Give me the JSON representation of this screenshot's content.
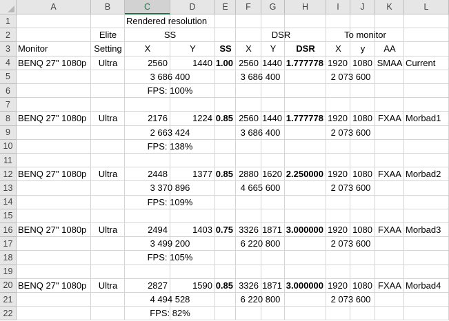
{
  "spreadsheet": {
    "columns": [
      "A",
      "B",
      "C",
      "D",
      "E",
      "F",
      "G",
      "H",
      "I",
      "J",
      "K",
      "L"
    ],
    "rows": [
      "1",
      "2",
      "3",
      "4",
      "5",
      "6",
      "7",
      "8",
      "9",
      "10",
      "11",
      "12",
      "13",
      "14",
      "15",
      "16",
      "17",
      "18",
      "19",
      "20",
      "21",
      "22"
    ],
    "cells": [
      {
        "r": 1,
        "c": "C",
        "text": "Rendered resolution",
        "align": "left"
      },
      {
        "r": 2,
        "c": "B",
        "text": "Elite",
        "align": "center"
      },
      {
        "r": 2,
        "c": "C",
        "text": "SS",
        "align": "center",
        "span": "CD"
      },
      {
        "r": 2,
        "c": "F",
        "text": "DSR",
        "align": "center",
        "span": "FH"
      },
      {
        "r": 2,
        "c": "I",
        "text": "To monitor",
        "align": "center",
        "span": "IK"
      },
      {
        "r": 3,
        "c": "A",
        "text": "Monitor",
        "align": "left"
      },
      {
        "r": 3,
        "c": "B",
        "text": "Setting",
        "align": "center"
      },
      {
        "r": 3,
        "c": "C",
        "text": "X",
        "align": "center",
        "span": "C"
      },
      {
        "r": 3,
        "c": "D",
        "text": "Y",
        "align": "center"
      },
      {
        "r": 3,
        "c": "E",
        "text": "SS",
        "align": "center",
        "bold": true
      },
      {
        "r": 3,
        "c": "F",
        "text": "X",
        "align": "center"
      },
      {
        "r": 3,
        "c": "G",
        "text": "Y",
        "align": "center"
      },
      {
        "r": 3,
        "c": "H",
        "text": "DSR",
        "align": "center",
        "bold": true
      },
      {
        "r": 3,
        "c": "I",
        "text": "X",
        "align": "center"
      },
      {
        "r": 3,
        "c": "J",
        "text": "y",
        "align": "center"
      },
      {
        "r": 3,
        "c": "K",
        "text": "AA",
        "align": "center"
      },
      {
        "r": 4,
        "c": "A",
        "text": "BENQ  27\" 1080p",
        "align": "left"
      },
      {
        "r": 4,
        "c": "B",
        "text": "Ultra",
        "align": "center"
      },
      {
        "r": 4,
        "c": "C",
        "text": "2560",
        "align": "right"
      },
      {
        "r": 4,
        "c": "D",
        "text": "1440",
        "align": "right"
      },
      {
        "r": 4,
        "c": "E",
        "text": "1.00",
        "align": "right",
        "bold": true
      },
      {
        "r": 4,
        "c": "F",
        "text": "2560",
        "align": "right"
      },
      {
        "r": 4,
        "c": "G",
        "text": "1440",
        "align": "right"
      },
      {
        "r": 4,
        "c": "H",
        "text": "1.777778",
        "align": "right",
        "bold": true
      },
      {
        "r": 4,
        "c": "I",
        "text": "1920",
        "align": "right"
      },
      {
        "r": 4,
        "c": "J",
        "text": "1080",
        "align": "right"
      },
      {
        "r": 4,
        "c": "K",
        "text": "SMAA",
        "align": "center"
      },
      {
        "r": 4,
        "c": "L",
        "text": "Current",
        "align": "left"
      },
      {
        "r": 5,
        "c": "C",
        "text": "3 686 400",
        "align": "center",
        "span": "CD"
      },
      {
        "r": 5,
        "c": "F",
        "text": "3 686 400",
        "align": "center",
        "span": "FG"
      },
      {
        "r": 5,
        "c": "I",
        "text": "2 073 600",
        "align": "center",
        "span": "IJ"
      },
      {
        "r": 6,
        "c": "C",
        "text": "FPS: 100%",
        "align": "center",
        "span": "CD"
      },
      {
        "r": 8,
        "c": "A",
        "text": "BENQ  27\" 1080p",
        "align": "left"
      },
      {
        "r": 8,
        "c": "B",
        "text": "Ultra",
        "align": "center"
      },
      {
        "r": 8,
        "c": "C",
        "text": "2176",
        "align": "right"
      },
      {
        "r": 8,
        "c": "D",
        "text": "1224",
        "align": "right"
      },
      {
        "r": 8,
        "c": "E",
        "text": "0.85",
        "align": "right",
        "bold": true
      },
      {
        "r": 8,
        "c": "F",
        "text": "2560",
        "align": "right"
      },
      {
        "r": 8,
        "c": "G",
        "text": "1440",
        "align": "right"
      },
      {
        "r": 8,
        "c": "H",
        "text": "1.777778",
        "align": "right",
        "bold": true
      },
      {
        "r": 8,
        "c": "I",
        "text": "1920",
        "align": "right"
      },
      {
        "r": 8,
        "c": "J",
        "text": "1080",
        "align": "right"
      },
      {
        "r": 8,
        "c": "K",
        "text": "FXAA",
        "align": "center"
      },
      {
        "r": 8,
        "c": "L",
        "text": "Morbad1",
        "align": "left"
      },
      {
        "r": 9,
        "c": "C",
        "text": "2 663 424",
        "align": "center",
        "span": "CD"
      },
      {
        "r": 9,
        "c": "F",
        "text": "3 686 400",
        "align": "center",
        "span": "FG"
      },
      {
        "r": 9,
        "c": "I",
        "text": "2 073 600",
        "align": "center",
        "span": "IJ"
      },
      {
        "r": 10,
        "c": "C",
        "text": "FPS: 138%",
        "align": "center",
        "span": "CD"
      },
      {
        "r": 12,
        "c": "A",
        "text": "BENQ  27\" 1080p",
        "align": "left"
      },
      {
        "r": 12,
        "c": "B",
        "text": "Ultra",
        "align": "center"
      },
      {
        "r": 12,
        "c": "C",
        "text": "2448",
        "align": "right"
      },
      {
        "r": 12,
        "c": "D",
        "text": "1377",
        "align": "right"
      },
      {
        "r": 12,
        "c": "E",
        "text": "0.85",
        "align": "right",
        "bold": true
      },
      {
        "r": 12,
        "c": "F",
        "text": "2880",
        "align": "right"
      },
      {
        "r": 12,
        "c": "G",
        "text": "1620",
        "align": "right"
      },
      {
        "r": 12,
        "c": "H",
        "text": "2.250000",
        "align": "right",
        "bold": true
      },
      {
        "r": 12,
        "c": "I",
        "text": "1920",
        "align": "right"
      },
      {
        "r": 12,
        "c": "J",
        "text": "1080",
        "align": "right"
      },
      {
        "r": 12,
        "c": "K",
        "text": "FXAA",
        "align": "center"
      },
      {
        "r": 12,
        "c": "L",
        "text": "Morbad2",
        "align": "left"
      },
      {
        "r": 13,
        "c": "C",
        "text": "3 370 896",
        "align": "center",
        "span": "CD"
      },
      {
        "r": 13,
        "c": "F",
        "text": "4 665 600",
        "align": "center",
        "span": "FG"
      },
      {
        "r": 13,
        "c": "I",
        "text": "2 073 600",
        "align": "center",
        "span": "IJ"
      },
      {
        "r": 14,
        "c": "C",
        "text": "FPS: 109%",
        "align": "center",
        "span": "CD"
      },
      {
        "r": 16,
        "c": "A",
        "text": "BENQ  27\" 1080p",
        "align": "left"
      },
      {
        "r": 16,
        "c": "B",
        "text": "Ultra",
        "align": "center"
      },
      {
        "r": 16,
        "c": "C",
        "text": "2494",
        "align": "right"
      },
      {
        "r": 16,
        "c": "D",
        "text": "1403",
        "align": "right"
      },
      {
        "r": 16,
        "c": "E",
        "text": "0.75",
        "align": "right",
        "bold": true
      },
      {
        "r": 16,
        "c": "F",
        "text": "3326",
        "align": "right"
      },
      {
        "r": 16,
        "c": "G",
        "text": "1871",
        "align": "right"
      },
      {
        "r": 16,
        "c": "H",
        "text": "3.000000",
        "align": "right",
        "bold": true
      },
      {
        "r": 16,
        "c": "I",
        "text": "1920",
        "align": "right"
      },
      {
        "r": 16,
        "c": "J",
        "text": "1080",
        "align": "right"
      },
      {
        "r": 16,
        "c": "K",
        "text": "FXAA",
        "align": "center"
      },
      {
        "r": 16,
        "c": "L",
        "text": "Morbad3",
        "align": "left"
      },
      {
        "r": 17,
        "c": "C",
        "text": "3 499 200",
        "align": "center",
        "span": "CD"
      },
      {
        "r": 17,
        "c": "F",
        "text": "6 220 800",
        "align": "center",
        "span": "FG"
      },
      {
        "r": 17,
        "c": "I",
        "text": "2 073 600",
        "align": "center",
        "span": "IJ"
      },
      {
        "r": 18,
        "c": "C",
        "text": "FPS: 105%",
        "align": "center",
        "span": "CD"
      },
      {
        "r": 20,
        "c": "A",
        "text": "BENQ  27\" 1080p",
        "align": "left"
      },
      {
        "r": 20,
        "c": "B",
        "text": "Ultra",
        "align": "center"
      },
      {
        "r": 20,
        "c": "C",
        "text": "2827",
        "align": "right"
      },
      {
        "r": 20,
        "c": "D",
        "text": "1590",
        "align": "right"
      },
      {
        "r": 20,
        "c": "E",
        "text": "0.85",
        "align": "right",
        "bold": true
      },
      {
        "r": 20,
        "c": "F",
        "text": "3326",
        "align": "right"
      },
      {
        "r": 20,
        "c": "G",
        "text": "1871",
        "align": "right"
      },
      {
        "r": 20,
        "c": "H",
        "text": "3.000000",
        "align": "right",
        "bold": true
      },
      {
        "r": 20,
        "c": "I",
        "text": "1920",
        "align": "right"
      },
      {
        "r": 20,
        "c": "J",
        "text": "1080",
        "align": "right"
      },
      {
        "r": 20,
        "c": "K",
        "text": "FXAA",
        "align": "center"
      },
      {
        "r": 20,
        "c": "L",
        "text": "Morbad4",
        "align": "left"
      },
      {
        "r": 21,
        "c": "C",
        "text": "4 494 528",
        "align": "center",
        "span": "CD"
      },
      {
        "r": 21,
        "c": "F",
        "text": "6 220 800",
        "align": "center",
        "span": "FG"
      },
      {
        "r": 21,
        "c": "I",
        "text": "2 073 600",
        "align": "center",
        "span": "IJ"
      },
      {
        "r": 22,
        "c": "C",
        "text": "FPS: 82%",
        "align": "center",
        "span": "CD"
      }
    ],
    "selected_column": "C",
    "colors": {
      "header_bg": "#e6e6e6",
      "grid": "#d4d4d4",
      "selected_header": "#217346"
    }
  }
}
